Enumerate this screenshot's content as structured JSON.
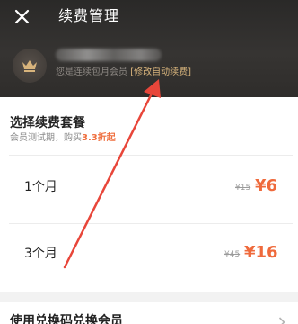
{
  "header": {
    "title": "续费管理",
    "member_status_prefix": "您是连续包月会员",
    "auto_renew_link": "[修改自动续费]"
  },
  "plans_section": {
    "title": "选择续费套餐",
    "subtitle_prefix": "会员测试期，购买",
    "subtitle_discount": "3.3折起"
  },
  "plans": [
    {
      "name": "1个月",
      "original_price": "¥15",
      "sale_price": "¥6"
    },
    {
      "name": "3个月",
      "original_price": "¥45",
      "sale_price": "¥16"
    }
  ],
  "bottom": {
    "label": "使用兑换码兑换会员"
  },
  "colors": {
    "header_bg": "#2f2d2b",
    "gold": "#d8b47c",
    "price": "#ef6a3c",
    "arrow": "#e8463a"
  }
}
